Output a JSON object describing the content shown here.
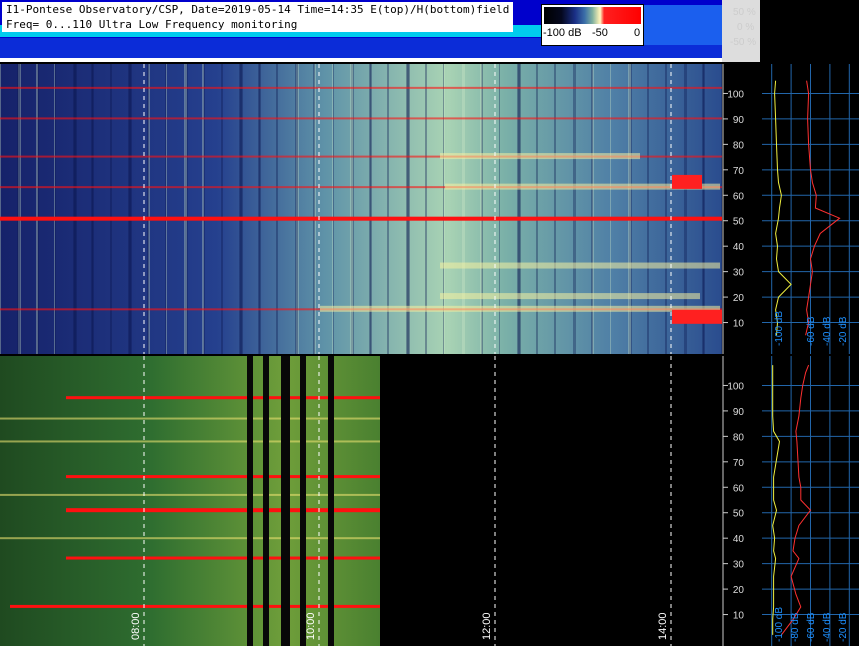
{
  "header": {
    "line1": "I1-Pontese Observatory/CSP, Date=2019-05-14 Time=14:35 E(top)/H(bottom)field",
    "line2": "Freq= 0...110 Ultra Low Frequency monitoring"
  },
  "colorbar": {
    "labels": [
      "-100 dB",
      "-50",
      "0"
    ]
  },
  "level_scale": [
    "50 %",
    "0 %",
    "-50 %"
  ],
  "colors": {
    "low": "#000000",
    "mid": "#2b4fa0",
    "high_green": "#9cc7a0",
    "yellow": "#f4f0a0",
    "red": "#ff0000",
    "spectrum_trace": "#f0f040",
    "avg_trace": "#ff3030",
    "grid": "#2266aa"
  },
  "chart_data": [
    {
      "type": "heatmap",
      "panel": "E field (top)",
      "ylim": [
        0,
        110
      ],
      "y_ticks": [
        10,
        20,
        30,
        40,
        50,
        60,
        70,
        80,
        90,
        100
      ],
      "x_ticks": [
        "08:00",
        "10:00",
        "12:00",
        "14:00"
      ],
      "note_lines_hz": [
        51,
        15,
        63,
        75,
        90,
        102
      ]
    },
    {
      "type": "heatmap",
      "panel": "H field (bottom)",
      "ylim": [
        0,
        110
      ],
      "y_ticks": [
        10,
        20,
        30,
        40,
        50,
        60,
        70,
        80,
        90,
        100
      ],
      "x_ticks": [
        "08:00",
        "10:00",
        "12:00",
        "14:00"
      ],
      "time_labels": [
        "08:00",
        "10:00",
        "12:00",
        "14:00"
      ],
      "note_lines_hz": [
        13,
        32,
        51,
        64,
        95
      ]
    },
    {
      "type": "line",
      "panel": "E field spectrum",
      "x_ticks": [
        "-100 dB",
        "-60 dB",
        "-40 dB",
        "-20 dB"
      ],
      "series": [
        {
          "x": [
            -95,
            -94,
            -96,
            -93,
            -80,
            -93,
            -95,
            -94,
            -96,
            -93,
            -92,
            -90,
            -93,
            -94,
            -95,
            -96,
            -97,
            -96
          ],
          "y": [
            5,
            10,
            15,
            20,
            25,
            30,
            35,
            40,
            45,
            51,
            55,
            60,
            65,
            70,
            80,
            90,
            100,
            105
          ]
        },
        {
          "x": [
            -65,
            -62,
            -64,
            -62,
            -60,
            -58,
            -60,
            -56,
            -50,
            -30,
            -55,
            -54,
            -58,
            -60,
            -62,
            -63,
            -62,
            -64
          ],
          "y": [
            5,
            10,
            15,
            20,
            25,
            30,
            35,
            40,
            45,
            51,
            55,
            60,
            65,
            70,
            80,
            90,
            100,
            105
          ]
        }
      ]
    },
    {
      "type": "line",
      "panel": "H field spectrum",
      "x_ticks": [
        "-100 dB",
        "-80 dB",
        "-60 dB",
        "-40 dB",
        "-20 dB"
      ],
      "series": [
        {
          "x": [
            -99,
            -99,
            -98,
            -98,
            -98,
            -96,
            -98,
            -97,
            -99,
            -95,
            -98,
            -98,
            -98,
            -92,
            -98,
            -99,
            -99,
            -99,
            -99,
            -99
          ],
          "y": [
            2,
            8,
            13,
            18,
            25,
            32,
            35,
            40,
            45,
            51,
            55,
            60,
            64,
            78,
            82,
            88,
            95,
            100,
            105,
            108
          ]
        },
        {
          "x": [
            -90,
            -78,
            -70,
            -75,
            -80,
            -72,
            -78,
            -76,
            -72,
            -60,
            -70,
            -70,
            -72,
            -74,
            -75,
            -72,
            -70,
            -68,
            -65,
            -62
          ],
          "y": [
            2,
            8,
            13,
            18,
            25,
            32,
            35,
            40,
            45,
            51,
            55,
            60,
            64,
            78,
            82,
            88,
            95,
            100,
            105,
            108
          ]
        }
      ]
    }
  ]
}
